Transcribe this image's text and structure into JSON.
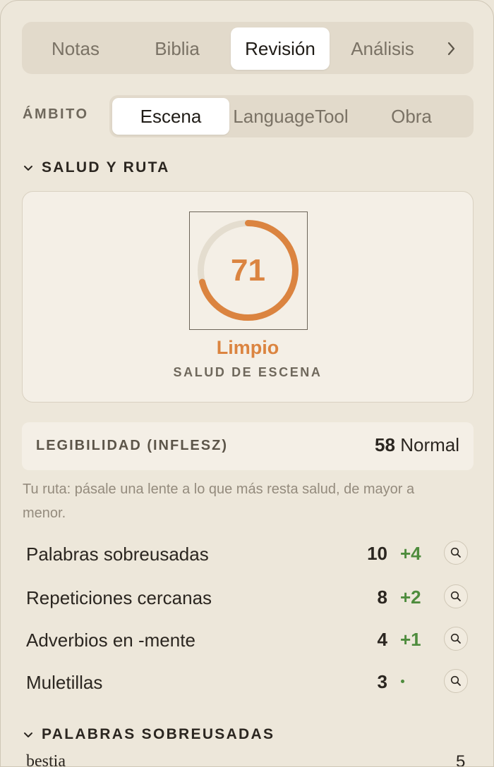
{
  "tabs": [
    {
      "label": "Notas",
      "active": false
    },
    {
      "label": "Biblia",
      "active": false
    },
    {
      "label": "Revisión",
      "active": true
    },
    {
      "label": "Análisis",
      "active": false
    }
  ],
  "tabs_more_icon": "chevron-right-icon",
  "scope": {
    "label": "ÁMBITO",
    "options": [
      {
        "label": "Escena",
        "active": true
      },
      {
        "label": "LanguageTool",
        "active": false
      },
      {
        "label": "Obra",
        "active": false
      }
    ]
  },
  "health_section": {
    "title": "SALUD Y RUTA",
    "score": "71",
    "score_fraction": 0.71,
    "status": "Limpio",
    "caption": "SALUD DE ESCENA"
  },
  "readability": {
    "label": "LEGIBILIDAD (INFLESZ)",
    "value": "58",
    "level": "Normal"
  },
  "route_hint": "Tu ruta: pásale una lente a lo que más resta salud, de mayor a menor.",
  "issues": [
    {
      "label": "Palabras sobreusadas",
      "count": "10",
      "delta": "+4"
    },
    {
      "label": "Repeticiones cercanas",
      "count": "8",
      "delta": "+2"
    },
    {
      "label": "Adverbios en -mente",
      "count": "4",
      "delta": "+1"
    },
    {
      "label": "Muletillas",
      "count": "3",
      "delta": ""
    }
  ],
  "overused_section": {
    "title": "PALABRAS SOBREUSADAS",
    "first_word": "bestia",
    "first_count": "5"
  },
  "colors": {
    "accent_orange": "#DB8440",
    "positive_green": "#4E8C3D",
    "panel_bg": "#EDE7DA"
  }
}
